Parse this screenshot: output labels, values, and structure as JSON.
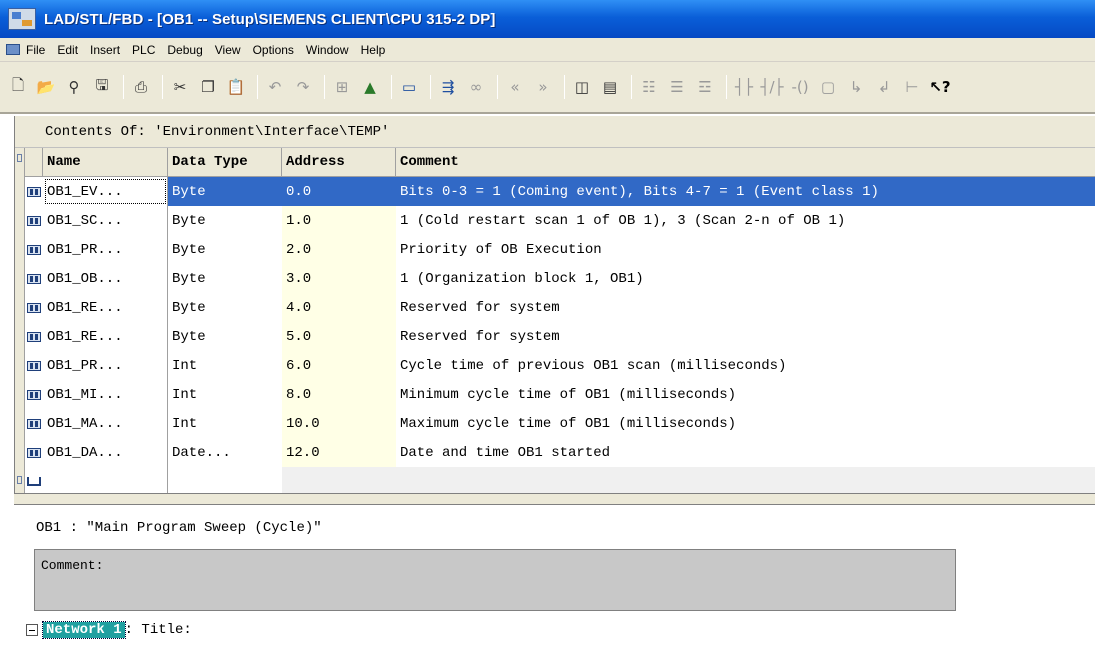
{
  "window": {
    "title": "LAD/STL/FBD  - [OB1 -- Setup\\SIEMENS CLIENT\\CPU 315-2 DP]"
  },
  "menu": [
    "File",
    "Edit",
    "Insert",
    "PLC",
    "Debug",
    "View",
    "Options",
    "Window",
    "Help"
  ],
  "toolbar": {
    "buttons": [
      "new-icon",
      "open-icon",
      "accessible-nodes-icon",
      "save-icon",
      "print-icon",
      "cut-icon",
      "copy-icon",
      "paste-icon",
      "undo-icon",
      "redo-icon",
      "view-icon",
      "overview-icon",
      "network-icon",
      "block-icon",
      "monitor-icon",
      "previous-icon",
      "next-icon",
      "program-elements-icon",
      "details-icon",
      "ladder-icon",
      "stl-icon",
      "fbd-icon",
      "contact-no-icon",
      "contact-nc-icon",
      "coil-icon",
      "box-icon",
      "branch-open-icon",
      "branch-close-icon",
      "help-icon"
    ]
  },
  "declaration": {
    "contents_label": "Contents Of:  'Environment\\Interface\\TEMP'",
    "columns": [
      "Name",
      "Data Type",
      "Address",
      "Comment"
    ],
    "rows": [
      {
        "name": "OB1_EV...",
        "type": "Byte",
        "address": "0.0",
        "comment": "Bits 0-3 = 1 (Coming event), Bits 4-7 = 1 (Event class 1)",
        "selected": true
      },
      {
        "name": "OB1_SC...",
        "type": "Byte",
        "address": "1.0",
        "comment": "1 (Cold restart scan 1 of OB 1), 3 (Scan 2-n of OB 1)"
      },
      {
        "name": "OB1_PR...",
        "type": "Byte",
        "address": "2.0",
        "comment": "Priority of OB Execution"
      },
      {
        "name": "OB1_OB...",
        "type": "Byte",
        "address": "3.0",
        "comment": "1 (Organization block 1, OB1)"
      },
      {
        "name": "OB1_RE...",
        "type": "Byte",
        "address": "4.0",
        "comment": "Reserved for system"
      },
      {
        "name": "OB1_RE...",
        "type": "Byte",
        "address": "5.0",
        "comment": "Reserved for system"
      },
      {
        "name": "OB1_PR...",
        "type": "Int",
        "address": "6.0",
        "comment": "Cycle time of previous OB1 scan (milliseconds)"
      },
      {
        "name": "OB1_MI...",
        "type": "Int",
        "address": "8.0",
        "comment": "Minimum cycle time of OB1 (milliseconds)"
      },
      {
        "name": "OB1_MA...",
        "type": "Int",
        "address": "10.0",
        "comment": "Maximum cycle time of OB1 (milliseconds)"
      },
      {
        "name": "OB1_DA...",
        "type": "Date...",
        "address": "12.0",
        "comment": "Date and time OB1 started"
      }
    ]
  },
  "code": {
    "ob_title": "OB1 :   \"Main Program Sweep (Cycle)\"",
    "comment_label": "Comment:",
    "network_label": "Network 1",
    "network_title": ": Title:"
  },
  "colors": {
    "titlebar": "#0a5fd8",
    "selection": "#3169c6",
    "address_bg": "#ffffe6",
    "network_badge": "#20a0a0",
    "comment_box": "#c8c8c8"
  }
}
